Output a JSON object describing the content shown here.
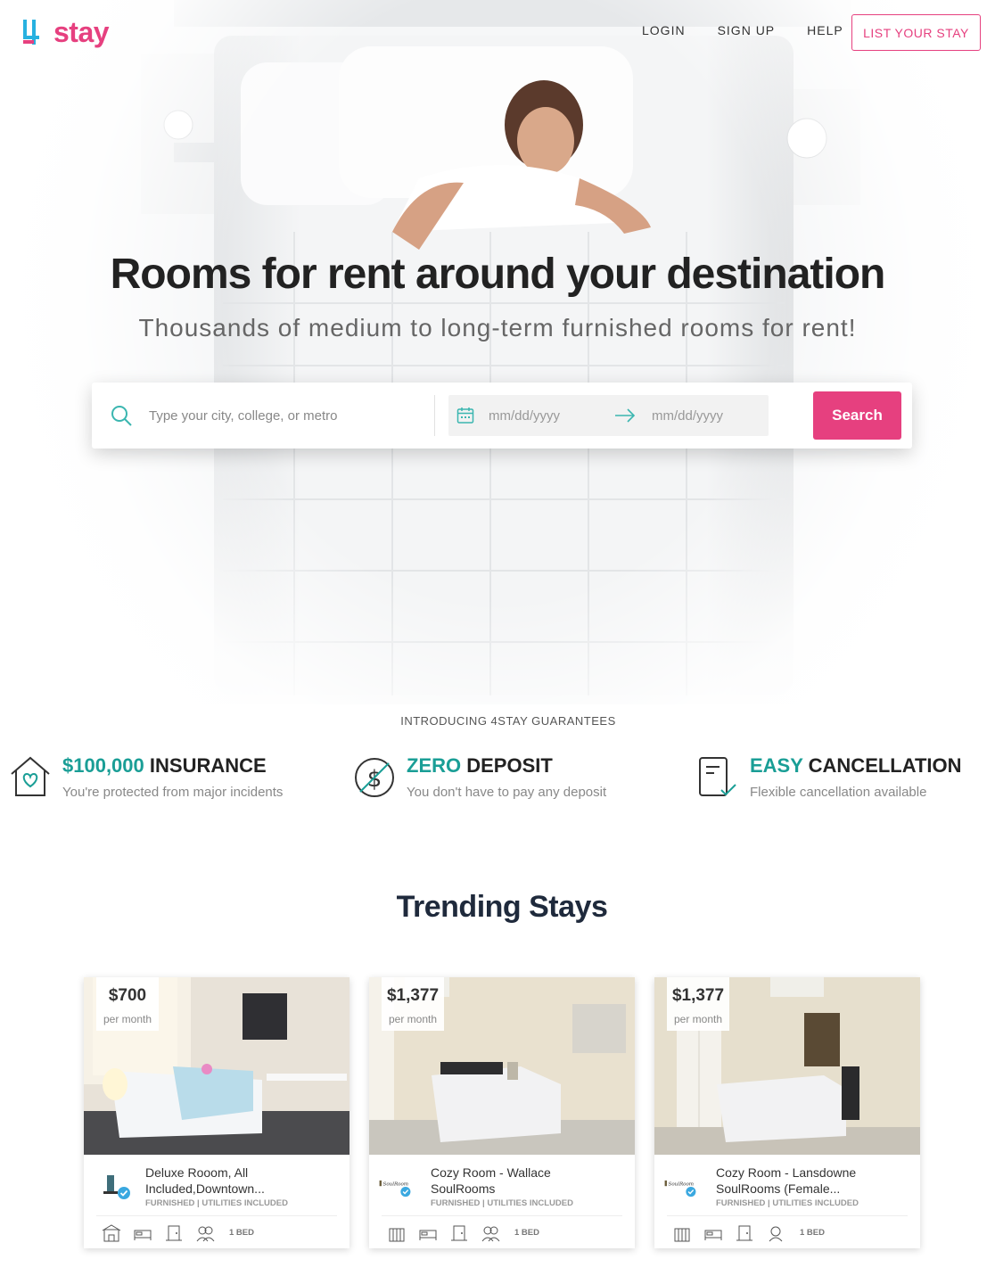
{
  "brand": {
    "name": "stay",
    "accent": "#e6407f",
    "teal": "#1a9e96",
    "logo_mark_color": "#27b1e0"
  },
  "nav": {
    "login": "LOGIN",
    "signup": "SIGN UP",
    "help": "HELP",
    "list_cta": "LIST YOUR STAY"
  },
  "hero": {
    "title": "Rooms for rent around your destination",
    "subtitle": "Thousands of medium to long-term furnished rooms for rent!"
  },
  "search": {
    "placeholder": "Type your city, college, or metro",
    "checkin_placeholder": "mm/dd/yyyy",
    "checkout_placeholder": "mm/dd/yyyy",
    "button": "Search"
  },
  "guarantees": {
    "intro": "INTRODUCING 4STAY GUARANTEES",
    "items": [
      {
        "icon": "house-heart-icon",
        "highlight": "$100,000",
        "title": "INSURANCE",
        "desc": "You're protected from major incidents"
      },
      {
        "icon": "no-dollar-icon",
        "highlight": "ZERO",
        "title": "DEPOSIT",
        "desc": "You don't have to pay any deposit"
      },
      {
        "icon": "document-check-icon",
        "highlight": "EASY",
        "title": "CANCELLATION",
        "desc": "Flexible cancellation available"
      }
    ]
  },
  "trending": {
    "title": "Trending Stays",
    "cards": [
      {
        "price": "$700",
        "per": "per month",
        "name_line1": "Deluxe Rooom, All",
        "name_line2": "Included,Downtown...",
        "tags": "FURNISHED | UTILITIES INCLUDED",
        "beds": "1 BED"
      },
      {
        "price": "$1,377",
        "per": "per month",
        "name_line1": "Cozy Room - Wallace",
        "name_line2": "SoulRooms",
        "tags": "FURNISHED | UTILITIES INCLUDED",
        "beds": "1 BED"
      },
      {
        "price": "$1,377",
        "per": "per month",
        "name_line1": "Cozy Room - Lansdowne",
        "name_line2": "SoulRooms (Female...",
        "tags": "FURNISHED | UTILITIES INCLUDED",
        "beds": "1 BED"
      }
    ]
  }
}
